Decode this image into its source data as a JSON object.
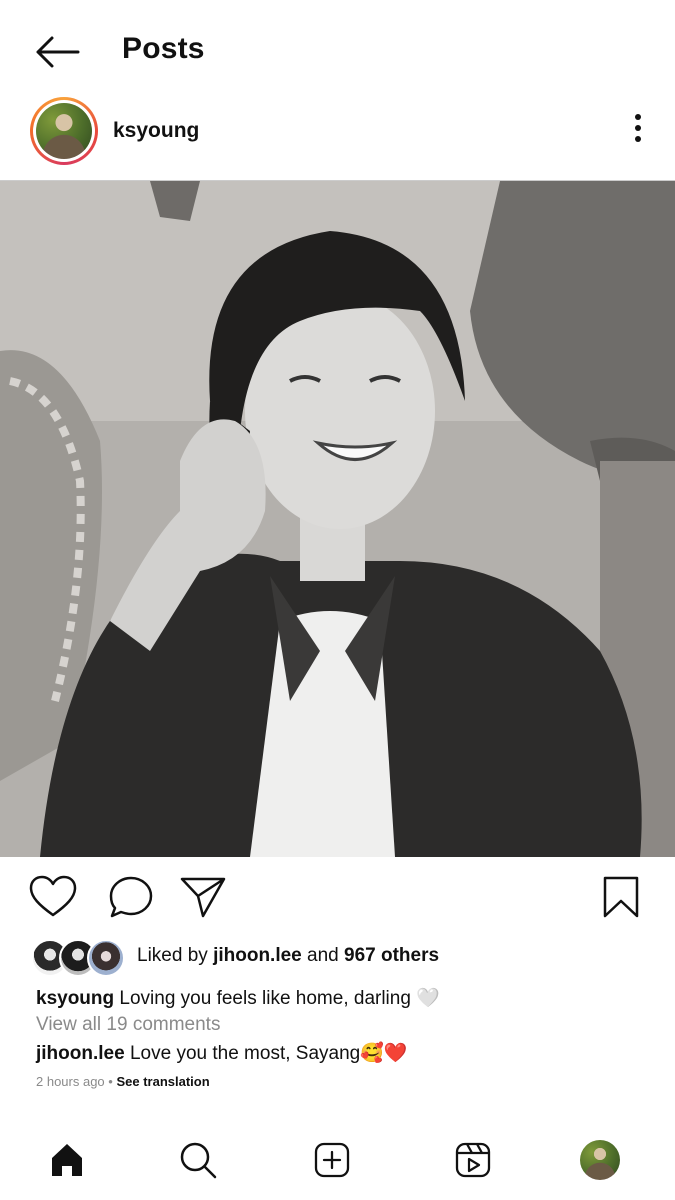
{
  "header": {
    "title": "Posts"
  },
  "post": {
    "username": "ksyoung",
    "image_alt": "grayscale photo of a smiling person in a dark jacket",
    "liked_by_prefix": "Liked by",
    "liked_by_user": "jihoon.lee",
    "liked_by_and": "and",
    "liked_by_others": "967 others",
    "caption_user": "ksyoung",
    "caption_text": "Loving you feels like home, darling 🤍",
    "view_comments": "View all 19 comments",
    "comment_user": "jihoon.lee",
    "comment_text": "Love you the most, Sayang🥰❤️",
    "time_ago": "2 hours ago",
    "separator": "•",
    "see_translation": "See translation"
  },
  "icons": {
    "back": "back-arrow-icon",
    "more": "more-vertical-icon",
    "like": "heart-icon",
    "comment": "comment-icon",
    "share": "paper-plane-icon",
    "save": "bookmark-icon",
    "nav": [
      "home-icon",
      "search-icon",
      "add-post-icon",
      "reels-icon",
      "profile-avatar"
    ]
  },
  "colors": {
    "story_ring": "#e84a3c",
    "heart_red": "#e0245e",
    "muted_text": "#8a8a8a"
  }
}
